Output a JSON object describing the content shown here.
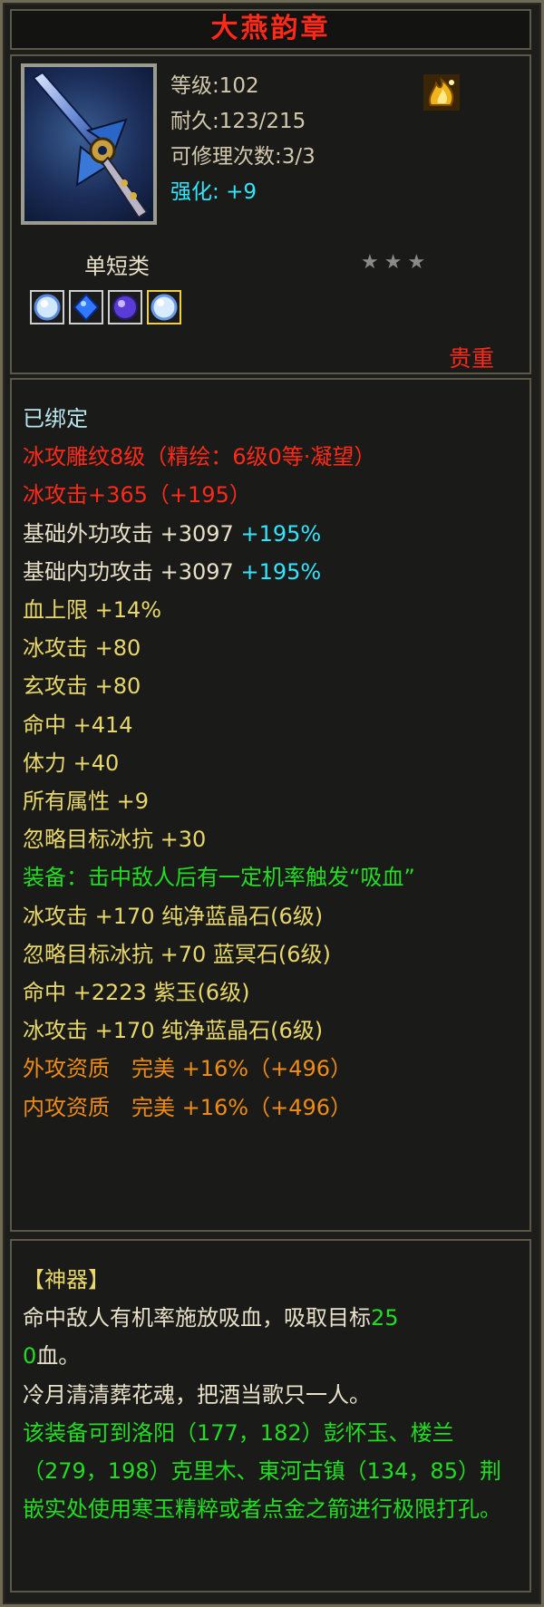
{
  "title": "大燕韵章",
  "item": {
    "level": "等级:102",
    "durability": "耐久:123/215",
    "repairs": "可修理次数:3/3",
    "enhance_label": "强化:",
    "enhance_value": "+9",
    "category": "单短类",
    "stars": "★★★",
    "rarity": "贵重"
  },
  "gems": [
    "blue-crystal-gem-icon",
    "blue-crystal-gem-icon",
    "purple-gem-icon",
    "blue-crystal-gem-icon"
  ],
  "colors": {
    "red": "#ff2a1a",
    "yellow": "#e8d76a",
    "green": "#22dd22",
    "orange": "#f08c14",
    "cyan": "#33e6ff",
    "white": "#e8e0c8"
  },
  "attributes": {
    "bound": "已绑定",
    "engrave": "冰攻雕纹8级（精绘：6级0等·凝望）",
    "ice_attack_main": "冰攻击+365（+195）",
    "base_outer": "基础外功攻击 +3097",
    "base_outer_pct": "+195%",
    "base_inner": "基础内功攻击 +3097",
    "base_inner_pct": "+195%",
    "hp_max": "血上限 +14%",
    "ice_atk": "冰攻击 +80",
    "mystic_atk": "玄攻击 +80",
    "hit": "命中 +414",
    "stamina": "体力 +40",
    "all_attr": "所有属性 +9",
    "ignore_ice": "忽略目标冰抗 +30",
    "equip_effect": "装备：击中敌人后有一定机率触发“吸血”",
    "gem1": "冰攻击 +170 纯净蓝晶石(6级)",
    "gem2": "忽略目标冰抗 +70 蓝冥石(6级)",
    "gem3": "命中 +2223 紫玉(6级)",
    "gem4": "冰攻击 +170 纯净蓝晶石(6级)",
    "outer_quality": "外攻资质　完美 +16%（+496）",
    "inner_quality": "内攻资质　完美 +16%（+496）"
  },
  "lore": {
    "header": "【神器】",
    "effect_text": "命中敌人有机率施放吸血，吸取目标",
    "effect_value_a": "25",
    "effect_value_b": "0",
    "effect_tail": "血。",
    "poem": "冷月清清葬花魂，把酒当歌只一人。",
    "socket_info": "该装备可到洛阳（177，182）彭怀玉、楼兰（279，198）克里木、東河古镇（134，85）荆嵌实处使用寒玉精粹或者点金之箭进行极限打孔。"
  }
}
